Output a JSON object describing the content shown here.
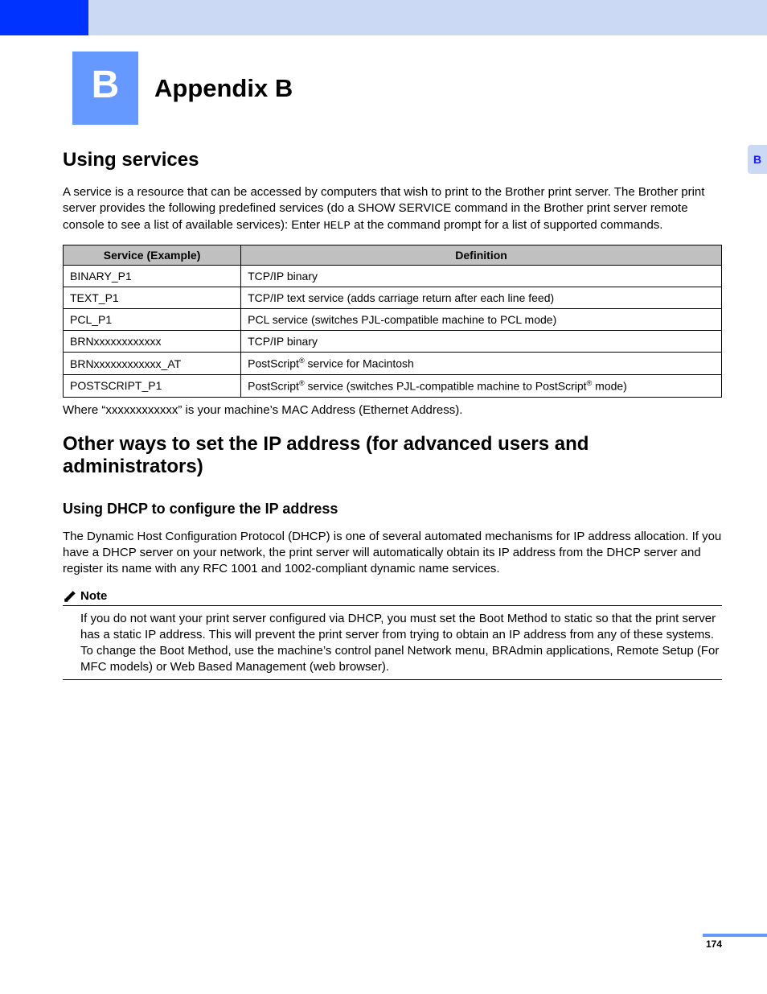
{
  "header": {
    "badge": "B",
    "title": "Appendix B"
  },
  "side_tab": "B",
  "page_number": "174",
  "section1": {
    "heading": "Using services",
    "intro_pre": "A service is a resource that can be accessed by computers that wish to print to the Brother print server. The Brother print server provides the following predefined services (do a SHOW SERVICE command in the Brother print server remote console to see a list of available services): Enter ",
    "intro_code": "HELP",
    "intro_post": " at the command prompt for a list of supported commands.",
    "table": {
      "col1": "Service (Example)",
      "col2": "Definition",
      "rows": [
        {
          "service": "BINARY_P1",
          "def_html": "TCP/IP binary"
        },
        {
          "service": "TEXT_P1",
          "def_html": "TCP/IP text service (adds carriage return after each line feed)"
        },
        {
          "service": "PCL_P1",
          "def_html": "PCL service (switches PJL-compatible machine to PCL mode)"
        },
        {
          "service": "BRNxxxxxxxxxxxx",
          "def_html": "TCP/IP binary"
        },
        {
          "service": "BRNxxxxxxxxxxxx_AT",
          "def_html": "PostScript<sup>®</sup> service for Macintosh"
        },
        {
          "service": "POSTSCRIPT_P1",
          "def_html": "PostScript<sup>®</sup> service (switches PJL-compatible machine to PostScript<sup>®</sup> mode)"
        }
      ]
    },
    "footnote": "Where “xxxxxxxxxxxx” is your machine’s MAC Address (Ethernet Address)."
  },
  "section2": {
    "heading": "Other ways to set the IP address (for advanced users and administrators)",
    "sub": {
      "heading": "Using DHCP to configure the IP address",
      "body": "The Dynamic Host Configuration Protocol (DHCP) is one of several automated mechanisms for IP address allocation. If you have a DHCP server on your network, the print server will automatically obtain its IP address from the DHCP server and register its name with any RFC 1001 and 1002-compliant dynamic name services."
    },
    "note": {
      "label": "Note",
      "text": "If you do not want your print server configured via DHCP, you must set the Boot Method to static so that the print server has a static IP address. This will prevent the print server from trying to obtain an IP address from any of these systems. To change the Boot Method, use the machine’s control panel Network menu, BRAdmin applications, Remote Setup (For MFC models) or Web Based Management (web browser)."
    }
  }
}
